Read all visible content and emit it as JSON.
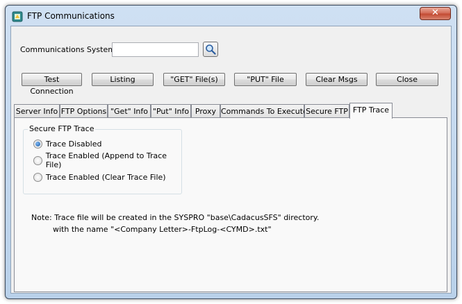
{
  "window": {
    "title": "FTP Communications",
    "close_label": "✕",
    "app_icon": "ftp-app-icon"
  },
  "form": {
    "comm_system_label": "Communications System :",
    "comm_system_value": "",
    "search_icon": "search-icon"
  },
  "buttons": {
    "test_connection": "Test Connection",
    "listing": "Listing",
    "get_files": "\"GET\" File(s)",
    "put_file": "\"PUT\" File",
    "clear_msgs": "Clear Msgs",
    "close": "Close"
  },
  "tabs": {
    "server_info": "Server Info",
    "ftp_options": "FTP Options",
    "get_info": "\"Get\" Info",
    "put_info": "\"Put\" Info",
    "proxy": "Proxy",
    "commands": "Commands To Execute",
    "secure_ftp": "Secure FTP",
    "ftp_trace": "FTP Trace",
    "active": "FTP Trace"
  },
  "trace": {
    "group_title": "Secure FTP Trace",
    "options": [
      {
        "label": "Trace Disabled",
        "selected": true
      },
      {
        "label": "Trace Enabled (Append to Trace File)",
        "selected": false
      },
      {
        "label": "Trace Enabled (Clear Trace File)",
        "selected": false
      }
    ],
    "note_line1": "Note: Trace file will be created in the SYSPRO \"base\\CadacusSFS\" directory.",
    "note_line2": "with the name \"<Company Letter>-FtpLog-<CYMD>.txt\""
  },
  "colors": {
    "title_bar": "#c4d9ef",
    "close_button": "#c9553c",
    "panel": "#f9f9f9",
    "radio_selected": "#1c5ea8"
  }
}
